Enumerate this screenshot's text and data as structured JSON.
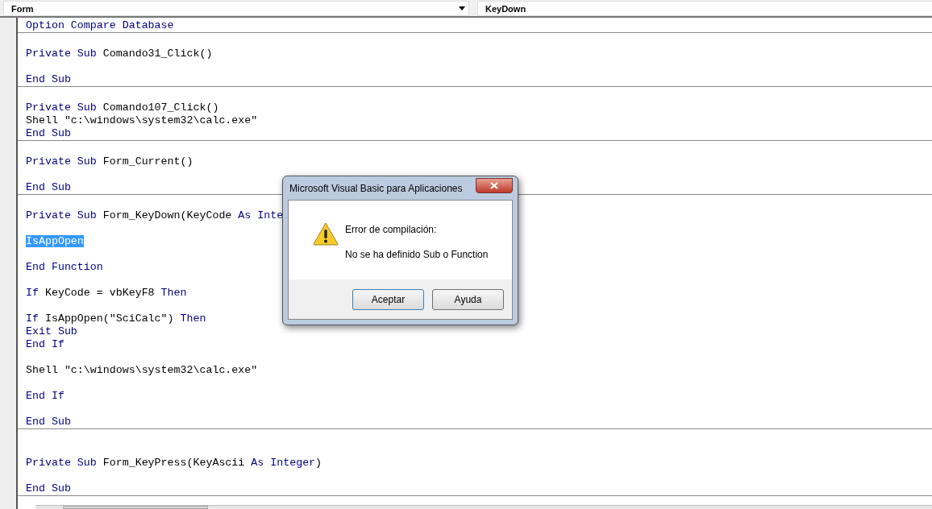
{
  "toolbar": {
    "object_dropdown": {
      "value": "Form"
    },
    "procedure_dropdown": {
      "value": "KeyDown"
    }
  },
  "code_blocks": [
    {
      "lines": [
        {
          "kind": "code",
          "selected": false,
          "segments": [
            {
              "text": "Option Compare Database",
              "kind": "keyword"
            }
          ]
        }
      ]
    },
    {
      "lines": [
        {
          "kind": "blank"
        },
        {
          "kind": "code",
          "selected": false,
          "segments": [
            {
              "text": "Private Sub",
              "kind": "keyword"
            },
            {
              "text": " Comando31_Click()",
              "kind": "plain"
            }
          ]
        },
        {
          "kind": "blank"
        },
        {
          "kind": "code",
          "selected": false,
          "segments": [
            {
              "text": "End Sub",
              "kind": "keyword"
            }
          ]
        }
      ]
    },
    {
      "lines": [
        {
          "kind": "blank"
        },
        {
          "kind": "code",
          "selected": false,
          "segments": [
            {
              "text": "Private Sub",
              "kind": "keyword"
            },
            {
              "text": " Comando107_Click()",
              "kind": "plain"
            }
          ]
        },
        {
          "kind": "code",
          "selected": false,
          "segments": [
            {
              "text": "Shell \"c:\\windows\\system32\\calc.exe\"",
              "kind": "plain"
            }
          ]
        },
        {
          "kind": "code",
          "selected": false,
          "segments": [
            {
              "text": "End Sub",
              "kind": "keyword"
            }
          ]
        }
      ]
    },
    {
      "lines": [
        {
          "kind": "blank"
        },
        {
          "kind": "code",
          "selected": false,
          "segments": [
            {
              "text": "Private Sub",
              "kind": "keyword"
            },
            {
              "text": " Form_Current()",
              "kind": "plain"
            }
          ]
        },
        {
          "kind": "blank"
        },
        {
          "kind": "code",
          "selected": false,
          "segments": [
            {
              "text": "End Sub",
              "kind": "keyword"
            }
          ]
        }
      ]
    },
    {
      "lines": [
        {
          "kind": "blank"
        },
        {
          "kind": "code",
          "selected": false,
          "segments": [
            {
              "text": "Private Sub",
              "kind": "keyword"
            },
            {
              "text": " Form_KeyDown(KeyCode ",
              "kind": "plain"
            },
            {
              "text": "As Inte",
              "kind": "keyword"
            }
          ]
        },
        {
          "kind": "blank"
        },
        {
          "kind": "code",
          "selected": true,
          "segments": [
            {
              "text": "IsAppOpen",
              "kind": "plain"
            }
          ]
        },
        {
          "kind": "blank"
        },
        {
          "kind": "code",
          "selected": false,
          "segments": [
            {
              "text": "End Function",
              "kind": "keyword"
            }
          ]
        },
        {
          "kind": "blank"
        },
        {
          "kind": "code",
          "selected": false,
          "segments": [
            {
              "text": "If",
              "kind": "keyword"
            },
            {
              "text": " KeyCode = vbKeyF8 ",
              "kind": "plain"
            },
            {
              "text": "Then",
              "kind": "keyword"
            }
          ]
        },
        {
          "kind": "blank"
        },
        {
          "kind": "code",
          "selected": false,
          "segments": [
            {
              "text": "If",
              "kind": "keyword"
            },
            {
              "text": " IsAppOpen(\"SciCalc\") ",
              "kind": "plain"
            },
            {
              "text": "Then",
              "kind": "keyword"
            }
          ]
        },
        {
          "kind": "code",
          "selected": false,
          "segments": [
            {
              "text": "Exit Sub",
              "kind": "keyword"
            }
          ]
        },
        {
          "kind": "code",
          "selected": false,
          "segments": [
            {
              "text": "End If",
              "kind": "keyword"
            }
          ]
        },
        {
          "kind": "blank"
        },
        {
          "kind": "code",
          "selected": false,
          "segments": [
            {
              "text": "Shell \"c:\\windows\\system32\\calc.exe\"",
              "kind": "plain"
            }
          ]
        },
        {
          "kind": "blank"
        },
        {
          "kind": "code",
          "selected": false,
          "segments": [
            {
              "text": "End If",
              "kind": "keyword"
            }
          ]
        },
        {
          "kind": "blank"
        },
        {
          "kind": "code",
          "selected": false,
          "segments": [
            {
              "text": "End Sub",
              "kind": "keyword"
            }
          ]
        }
      ]
    },
    {
      "lines": [
        {
          "kind": "blank"
        },
        {
          "kind": "blank"
        },
        {
          "kind": "code",
          "selected": false,
          "segments": [
            {
              "text": "Private Sub",
              "kind": "keyword"
            },
            {
              "text": " Form_KeyPress(KeyAscii ",
              "kind": "plain"
            },
            {
              "text": "As Integer",
              "kind": "keyword"
            },
            {
              "text": ")",
              "kind": "plain"
            }
          ]
        },
        {
          "kind": "blank"
        },
        {
          "kind": "code",
          "selected": false,
          "segments": [
            {
              "text": "End Sub",
              "kind": "keyword"
            }
          ]
        }
      ]
    }
  ],
  "dialog": {
    "title": "Microsoft Visual Basic para Aplicaciones",
    "heading": "Error de compilación:",
    "message": "No se ha definido Sub o Function",
    "buttons": [
      {
        "label": "Aceptar",
        "default": true
      },
      {
        "label": "Ayuda",
        "default": false
      }
    ]
  }
}
